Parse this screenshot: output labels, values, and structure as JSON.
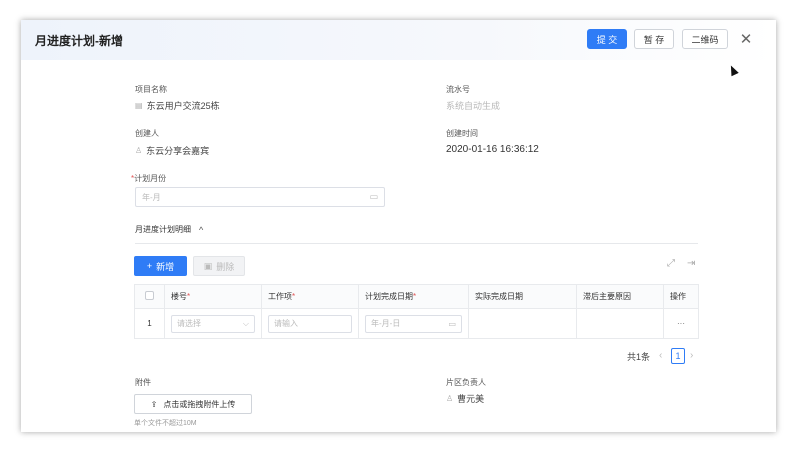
{
  "dialog": {
    "title": "月进度计划-新增",
    "submit_label": "提 交",
    "save_label": "暂 存",
    "qrcode_label": "二维码",
    "close_glyph": "✕"
  },
  "form": {
    "project_name_label": "项目名称",
    "project_name_value": "东云用户交流25栋",
    "serial_label": "流水号",
    "serial_placeholder": "系统自动生成",
    "creator_label": "创建人",
    "creator_value": "东云分享会嘉宾",
    "created_time_label": "创建时间",
    "created_time_value": "2020-01-16 16:36:12",
    "plan_month_label": "计划月份",
    "plan_month_required": "*",
    "plan_month_placeholder": "年-月"
  },
  "detail": {
    "section_title": "月进度计划明细",
    "add_label": "新增",
    "delete_label": "删除",
    "columns": {
      "building": "楼号",
      "work_item": "工作项",
      "plan_date": "计划完成日期",
      "actual_date": "实际完成日期",
      "delay_reason": "滞后主要原因",
      "operation": "操作"
    },
    "required_mark": "*",
    "rows": [
      {
        "index": "1",
        "building_placeholder": "请选择",
        "work_item_placeholder": "请输入",
        "plan_date_placeholder": "年-月-日",
        "operation": "···"
      }
    ],
    "pager": {
      "total_text": "共1条",
      "current_page": "1"
    }
  },
  "footer": {
    "attachment_label": "附件",
    "upload_label": "点击或拖拽附件上传",
    "upload_hint": "单个文件不超过10M",
    "district_owner_label": "片区负责人",
    "district_owner_value": "曹元美"
  },
  "colors": {
    "primary": "#2f7cf6",
    "required": "#e05555"
  }
}
